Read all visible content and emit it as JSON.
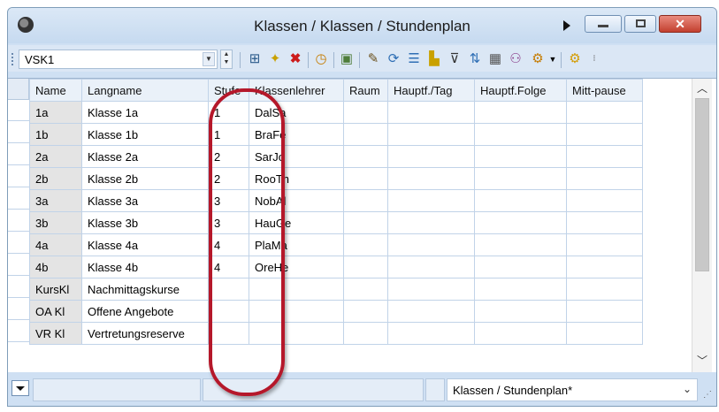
{
  "window": {
    "title": "Klassen / Klassen / Stundenplan"
  },
  "toolbar": {
    "selected_class": "VSK1",
    "icons": [
      "go-to-icon",
      "new-record-icon",
      "delete-icon",
      "clock-icon",
      "copy-icon",
      "edit-icon",
      "refresh-icon",
      "list-icon",
      "chart-icon",
      "filter-icon",
      "sort-icon",
      "table-icon",
      "users-icon",
      "settings-dropdown-icon",
      "gear-icon"
    ]
  },
  "grid": {
    "columns": [
      "Name",
      "Langname",
      "Stufe",
      "Klassenlehrer",
      "Raum",
      "Hauptf./Tag",
      "Hauptf.Folge",
      "Mitt-pause"
    ],
    "rows": [
      {
        "name": "1a",
        "langname": "Klasse 1a",
        "stufe": "1",
        "lehrer": "DalSa"
      },
      {
        "name": "1b",
        "langname": "Klasse 1b",
        "stufe": "1",
        "lehrer": "BraFe"
      },
      {
        "name": "2a",
        "langname": "Klasse 2a",
        "stufe": "2",
        "lehrer": "SarJo"
      },
      {
        "name": "2b",
        "langname": "Klasse 2b",
        "stufe": "2",
        "lehrer": "RooTh"
      },
      {
        "name": "3a",
        "langname": "Klasse 3a",
        "stufe": "3",
        "lehrer": "NobAl"
      },
      {
        "name": "3b",
        "langname": "Klasse 3b",
        "stufe": "3",
        "lehrer": "HauGe"
      },
      {
        "name": "4a",
        "langname": "Klasse 4a",
        "stufe": "4",
        "lehrer": "PlaMa"
      },
      {
        "name": "4b",
        "langname": "Klasse 4b",
        "stufe": "4",
        "lehrer": "OreHe"
      },
      {
        "name": "KursKl",
        "langname": "Nachmittagskurse",
        "stufe": "",
        "lehrer": ""
      },
      {
        "name": "OA Kl",
        "langname": "Offene Angebote",
        "stufe": "",
        "lehrer": ""
      },
      {
        "name": "VR Kl",
        "langname": "Vertretungsreserve",
        "stufe": "",
        "lehrer": ""
      }
    ]
  },
  "statusbar": {
    "view_name": "Klassen / Stundenplan*"
  },
  "colors": {
    "highlight": "#b5182a",
    "close_button": "#c3402f",
    "name_cell": "#e4e4e4"
  }
}
